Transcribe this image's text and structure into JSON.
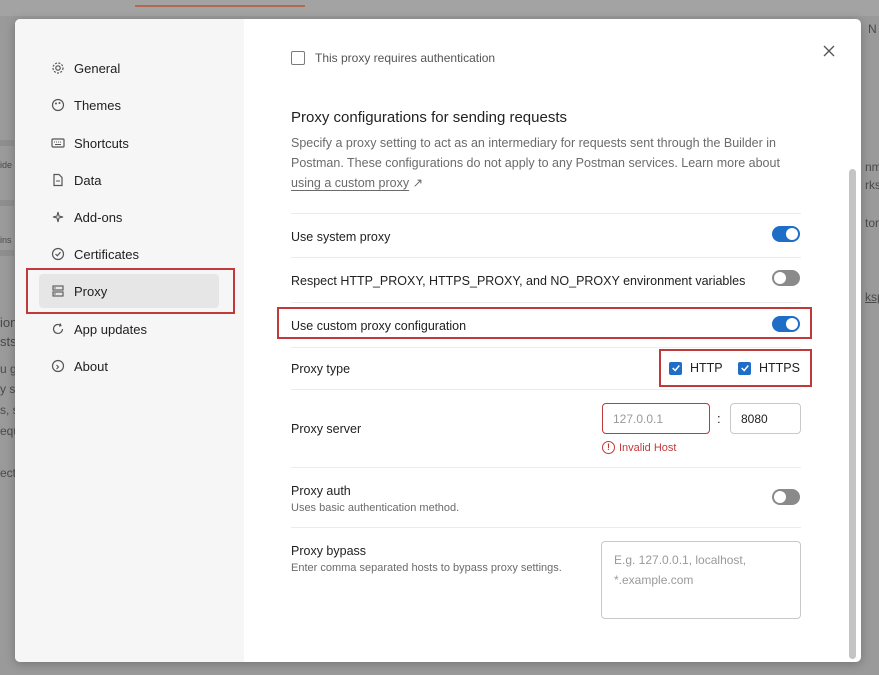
{
  "background": {
    "fragments": [
      "N",
      "ide",
      "ins",
      "ion",
      "sts",
      "u g",
      "y s",
      "s, s",
      "equ",
      "ect",
      "nm",
      "rks",
      "tors",
      "ksp"
    ]
  },
  "sidebar": {
    "items": [
      {
        "label": "General",
        "icon": "gear-icon"
      },
      {
        "label": "Themes",
        "icon": "palette-icon"
      },
      {
        "label": "Shortcuts",
        "icon": "keyboard-icon"
      },
      {
        "label": "Data",
        "icon": "file-icon"
      },
      {
        "label": "Add-ons",
        "icon": "sparkle-icon"
      },
      {
        "label": "Certificates",
        "icon": "certificate-icon"
      },
      {
        "label": "Proxy",
        "icon": "proxy-icon"
      },
      {
        "label": "App updates",
        "icon": "refresh-icon"
      },
      {
        "label": "About",
        "icon": "info-icon"
      }
    ],
    "active": "Proxy"
  },
  "content": {
    "auth_checkbox_label": "This proxy requires authentication",
    "section_title": "Proxy configurations for sending requests",
    "section_desc": "Specify a proxy setting to act as an intermediary for requests sent through the Builder in Postman. These configurations do not apply to any Postman services. Learn more about",
    "section_link": "using a custom proxy",
    "link_arrow": "↗",
    "rows": {
      "system_proxy": {
        "label": "Use system proxy",
        "enabled": true
      },
      "env_vars": {
        "label": "Respect HTTP_PROXY, HTTPS_PROXY, and NO_PROXY environment variables",
        "enabled": false
      },
      "custom_proxy": {
        "label": "Use custom proxy configuration",
        "enabled": true
      },
      "proxy_type": {
        "label": "Proxy type",
        "http_label": "HTTP",
        "https_label": "HTTPS",
        "http_checked": true,
        "https_checked": true
      },
      "proxy_server": {
        "label": "Proxy server",
        "host_placeholder": "127.0.0.1",
        "separator": ":",
        "port_value": "8080",
        "error": "Invalid Host",
        "error_icon": "!"
      },
      "proxy_auth": {
        "label": "Proxy auth",
        "sub": "Uses basic authentication method.",
        "enabled": false
      },
      "proxy_bypass": {
        "label": "Proxy bypass",
        "sub": "Enter comma separated hosts to bypass proxy settings.",
        "placeholder": "E.g. 127.0.0.1, localhost, *.example.com"
      }
    }
  },
  "colors": {
    "accent": "#1e6ec8",
    "highlight": "#c0393b",
    "error": "#c0393b"
  }
}
